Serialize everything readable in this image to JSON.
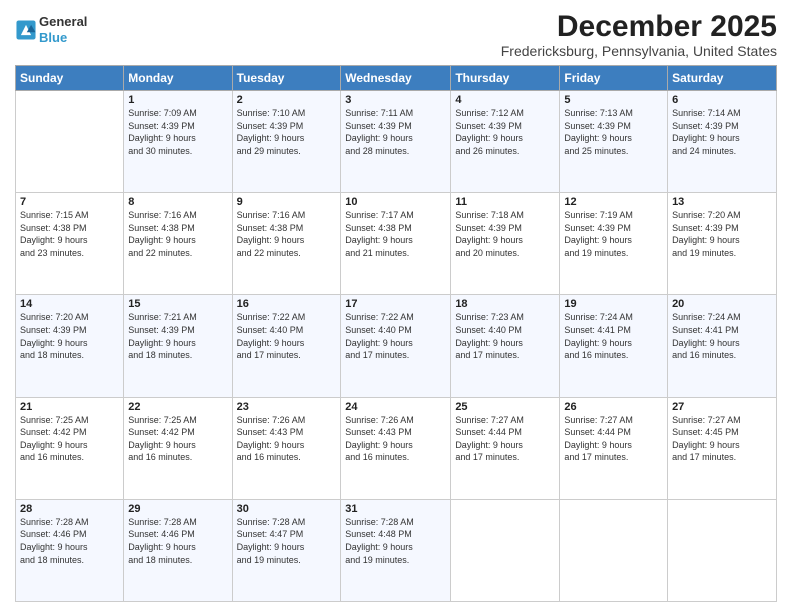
{
  "logo": {
    "line1": "General",
    "line2": "Blue"
  },
  "title": "December 2025",
  "subtitle": "Fredericksburg, Pennsylvania, United States",
  "days_header": [
    "Sunday",
    "Monday",
    "Tuesday",
    "Wednesday",
    "Thursday",
    "Friday",
    "Saturday"
  ],
  "weeks": [
    [
      {
        "num": "",
        "info": ""
      },
      {
        "num": "1",
        "info": "Sunrise: 7:09 AM\nSunset: 4:39 PM\nDaylight: 9 hours\nand 30 minutes."
      },
      {
        "num": "2",
        "info": "Sunrise: 7:10 AM\nSunset: 4:39 PM\nDaylight: 9 hours\nand 29 minutes."
      },
      {
        "num": "3",
        "info": "Sunrise: 7:11 AM\nSunset: 4:39 PM\nDaylight: 9 hours\nand 28 minutes."
      },
      {
        "num": "4",
        "info": "Sunrise: 7:12 AM\nSunset: 4:39 PM\nDaylight: 9 hours\nand 26 minutes."
      },
      {
        "num": "5",
        "info": "Sunrise: 7:13 AM\nSunset: 4:39 PM\nDaylight: 9 hours\nand 25 minutes."
      },
      {
        "num": "6",
        "info": "Sunrise: 7:14 AM\nSunset: 4:39 PM\nDaylight: 9 hours\nand 24 minutes."
      }
    ],
    [
      {
        "num": "7",
        "info": "Sunrise: 7:15 AM\nSunset: 4:38 PM\nDaylight: 9 hours\nand 23 minutes."
      },
      {
        "num": "8",
        "info": "Sunrise: 7:16 AM\nSunset: 4:38 PM\nDaylight: 9 hours\nand 22 minutes."
      },
      {
        "num": "9",
        "info": "Sunrise: 7:16 AM\nSunset: 4:38 PM\nDaylight: 9 hours\nand 22 minutes."
      },
      {
        "num": "10",
        "info": "Sunrise: 7:17 AM\nSunset: 4:38 PM\nDaylight: 9 hours\nand 21 minutes."
      },
      {
        "num": "11",
        "info": "Sunrise: 7:18 AM\nSunset: 4:39 PM\nDaylight: 9 hours\nand 20 minutes."
      },
      {
        "num": "12",
        "info": "Sunrise: 7:19 AM\nSunset: 4:39 PM\nDaylight: 9 hours\nand 19 minutes."
      },
      {
        "num": "13",
        "info": "Sunrise: 7:20 AM\nSunset: 4:39 PM\nDaylight: 9 hours\nand 19 minutes."
      }
    ],
    [
      {
        "num": "14",
        "info": "Sunrise: 7:20 AM\nSunset: 4:39 PM\nDaylight: 9 hours\nand 18 minutes."
      },
      {
        "num": "15",
        "info": "Sunrise: 7:21 AM\nSunset: 4:39 PM\nDaylight: 9 hours\nand 18 minutes."
      },
      {
        "num": "16",
        "info": "Sunrise: 7:22 AM\nSunset: 4:40 PM\nDaylight: 9 hours\nand 17 minutes."
      },
      {
        "num": "17",
        "info": "Sunrise: 7:22 AM\nSunset: 4:40 PM\nDaylight: 9 hours\nand 17 minutes."
      },
      {
        "num": "18",
        "info": "Sunrise: 7:23 AM\nSunset: 4:40 PM\nDaylight: 9 hours\nand 17 minutes."
      },
      {
        "num": "19",
        "info": "Sunrise: 7:24 AM\nSunset: 4:41 PM\nDaylight: 9 hours\nand 16 minutes."
      },
      {
        "num": "20",
        "info": "Sunrise: 7:24 AM\nSunset: 4:41 PM\nDaylight: 9 hours\nand 16 minutes."
      }
    ],
    [
      {
        "num": "21",
        "info": "Sunrise: 7:25 AM\nSunset: 4:42 PM\nDaylight: 9 hours\nand 16 minutes."
      },
      {
        "num": "22",
        "info": "Sunrise: 7:25 AM\nSunset: 4:42 PM\nDaylight: 9 hours\nand 16 minutes."
      },
      {
        "num": "23",
        "info": "Sunrise: 7:26 AM\nSunset: 4:43 PM\nDaylight: 9 hours\nand 16 minutes."
      },
      {
        "num": "24",
        "info": "Sunrise: 7:26 AM\nSunset: 4:43 PM\nDaylight: 9 hours\nand 16 minutes."
      },
      {
        "num": "25",
        "info": "Sunrise: 7:27 AM\nSunset: 4:44 PM\nDaylight: 9 hours\nand 17 minutes."
      },
      {
        "num": "26",
        "info": "Sunrise: 7:27 AM\nSunset: 4:44 PM\nDaylight: 9 hours\nand 17 minutes."
      },
      {
        "num": "27",
        "info": "Sunrise: 7:27 AM\nSunset: 4:45 PM\nDaylight: 9 hours\nand 17 minutes."
      }
    ],
    [
      {
        "num": "28",
        "info": "Sunrise: 7:28 AM\nSunset: 4:46 PM\nDaylight: 9 hours\nand 18 minutes."
      },
      {
        "num": "29",
        "info": "Sunrise: 7:28 AM\nSunset: 4:46 PM\nDaylight: 9 hours\nand 18 minutes."
      },
      {
        "num": "30",
        "info": "Sunrise: 7:28 AM\nSunset: 4:47 PM\nDaylight: 9 hours\nand 19 minutes."
      },
      {
        "num": "31",
        "info": "Sunrise: 7:28 AM\nSunset: 4:48 PM\nDaylight: 9 hours\nand 19 minutes."
      },
      {
        "num": "",
        "info": ""
      },
      {
        "num": "",
        "info": ""
      },
      {
        "num": "",
        "info": ""
      }
    ]
  ]
}
